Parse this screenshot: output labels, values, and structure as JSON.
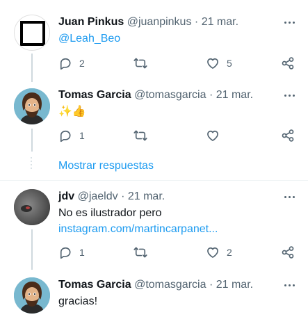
{
  "tweets": [
    {
      "name": "Juan Pinkus",
      "handle": "@juanpinkus",
      "sep": "·",
      "date": "21 mar.",
      "text": "@Leah_Beo",
      "replies": "2",
      "retweets": "",
      "likes": "5"
    },
    {
      "name": "Tomas Garcia",
      "handle": "@tomasgarcia",
      "sep": "·",
      "date": "21 mar.",
      "text": "✨👍",
      "replies": "1",
      "retweets": "",
      "likes": ""
    },
    {
      "name": "jdv",
      "handle": "@jaeldv",
      "sep": "·",
      "date": "21 mar.",
      "text": "No es ilustrador pero",
      "link": "instagram.com/martincarpanet...",
      "replies": "1",
      "retweets": "",
      "likes": "2"
    },
    {
      "name": "Tomas Garcia",
      "handle": "@tomasgarcia",
      "sep": "·",
      "date": "21 mar.",
      "text": "gracias!"
    }
  ],
  "show_more": "Mostrar respuestas",
  "colors": {
    "accent": "#1d9bf0",
    "secondary_text": "#536471",
    "thread_line": "#cfd9de"
  },
  "icons": [
    "reply-icon",
    "retweet-icon",
    "like-icon",
    "share-icon",
    "more-icon"
  ]
}
